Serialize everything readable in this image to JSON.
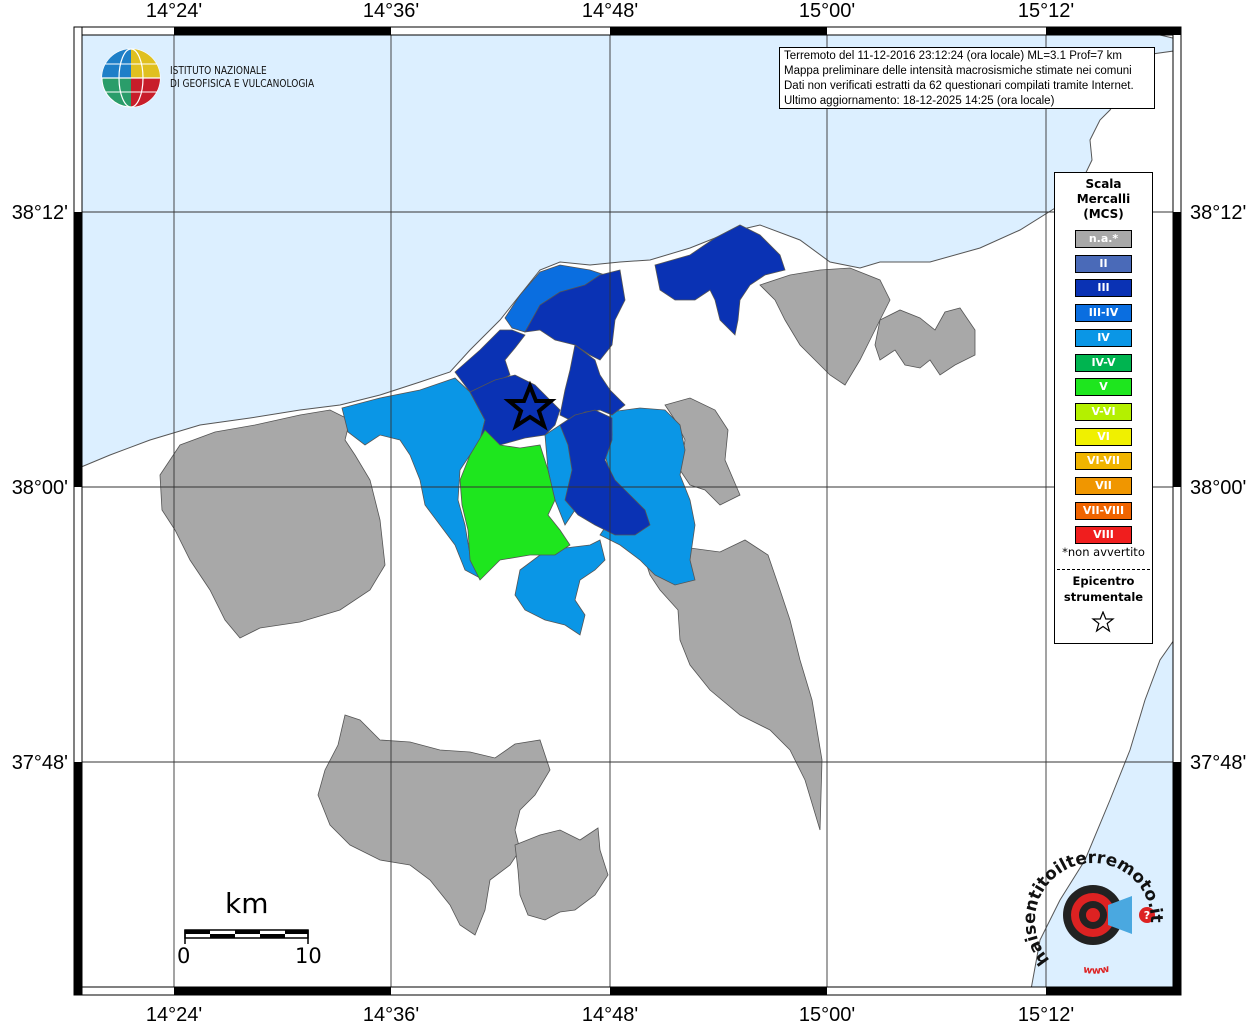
{
  "institute": {
    "name_line1": "ISTITUTO NAZIONALE",
    "name_line2": "DI GEOFISICA E VULCANOLOGIA"
  },
  "info_box": {
    "line1": "Terremoto del 11-12-2016 23:12:24 (ora locale) ML=3.1 Prof=7 km",
    "line2": "Mappa preliminare delle intensità macrosismiche stimate nei comuni",
    "line3": "Dati non verificati estratti da 62 questionari compilati tramite Internet.",
    "line4": "Ultimo aggiornamento: 18-12-2025 14:25 (ora locale)"
  },
  "axes": {
    "top": [
      "14°24'",
      "14°36'",
      "14°48'",
      "15°00'",
      "15°12'"
    ],
    "bottom": [
      "14°24'",
      "14°36'",
      "14°48'",
      "15°00'",
      "15°12'"
    ],
    "left": [
      "38°12'",
      "38°00'",
      "37°48'"
    ],
    "right": [
      "38°12'",
      "38°00'",
      "37°48'"
    ]
  },
  "legend": {
    "title_line1": "Scala",
    "title_line2": "Mercalli",
    "title_line3": "(MCS)",
    "items": [
      {
        "label": "n.a.*",
        "color": "#a8a8a8"
      },
      {
        "label": "II",
        "color": "#4a6ab8"
      },
      {
        "label": "III",
        "color": "#0a32b4"
      },
      {
        "label": "III-IV",
        "color": "#0a6ee0"
      },
      {
        "label": "IV",
        "color": "#0a96e6"
      },
      {
        "label": "IV-V",
        "color": "#00b450"
      },
      {
        "label": "V",
        "color": "#1ee61e"
      },
      {
        "label": "V-VI",
        "color": "#b4f000"
      },
      {
        "label": "VI",
        "color": "#f0f000"
      },
      {
        "label": "VI-VII",
        "color": "#f0b400"
      },
      {
        "label": "VII",
        "color": "#f09600"
      },
      {
        "label": "VII-VIII",
        "color": "#f06400"
      },
      {
        "label": "VIII",
        "color": "#f01e1e"
      }
    ],
    "note": "*non avvertito",
    "epicentre_line1": "Epicentro",
    "epicentre_line2": "strumentale"
  },
  "scale_bar": {
    "unit": "km",
    "start": "0",
    "end": "10"
  },
  "watermark": {
    "text": "haisentitoilterremoto.it",
    "url": "www"
  },
  "colors": {
    "sea": "#dcefff",
    "land": "#ffffff",
    "na": "#a8a8a8",
    "III": "#0a32b4",
    "III_IV": "#0a6ee0",
    "IV": "#0a96e6",
    "V": "#1ee61e"
  }
}
